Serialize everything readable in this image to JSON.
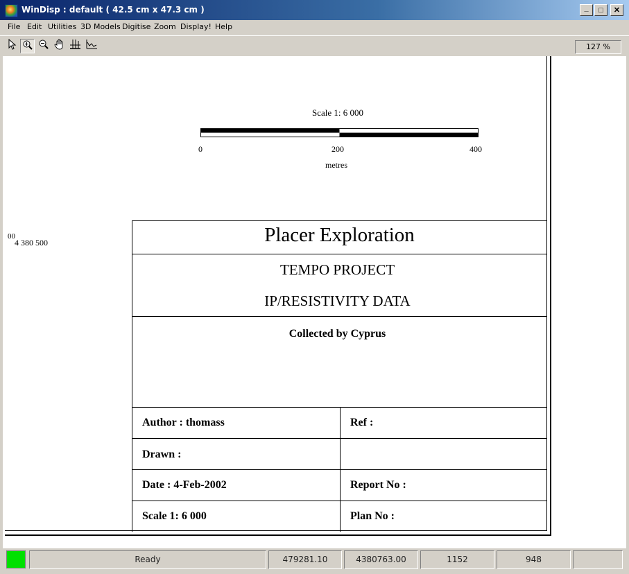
{
  "window": {
    "title": "WinDisp : default ( 42.5 cm x 47.3 cm )",
    "controls": {
      "minimize": "_",
      "maximize": "□",
      "close": "✕"
    }
  },
  "menu": [
    "File",
    "Edit",
    "Utilities",
    "3D Models",
    "Digitise",
    "Zoom",
    "Display!",
    "Help"
  ],
  "toolbar": {
    "tools": [
      "pointer-icon",
      "zoom-in-icon",
      "zoom-out-icon",
      "pan-hand-icon",
      "grid-icon",
      "profile-icon"
    ],
    "zoom_level": "127 %"
  },
  "map": {
    "scale_label": "Scale 1:  6 000",
    "scale_ticks": [
      "0",
      "200",
      "400"
    ],
    "scale_unit": "metres",
    "coord_partial": "00",
    "coord_label": "4  380  500"
  },
  "title_block": {
    "company": "Placer Exploration",
    "project": "TEMPO PROJECT",
    "data_type": "IP/RESISTIVITY DATA",
    "collected": "Collected by Cyprus",
    "author": "Author : thomass",
    "ref": "Ref :",
    "drawn": "Drawn :",
    "date": "Date : 4-Feb-2002",
    "report": "Report No :",
    "scale": "Scale 1:  6 000",
    "plan": "Plan No :"
  },
  "status": {
    "state": "Ready",
    "x": "479281.10",
    "y": "4380763.00",
    "px": "1152",
    "py": "948",
    "extra": "",
    "indicator_color": "#00e000"
  }
}
